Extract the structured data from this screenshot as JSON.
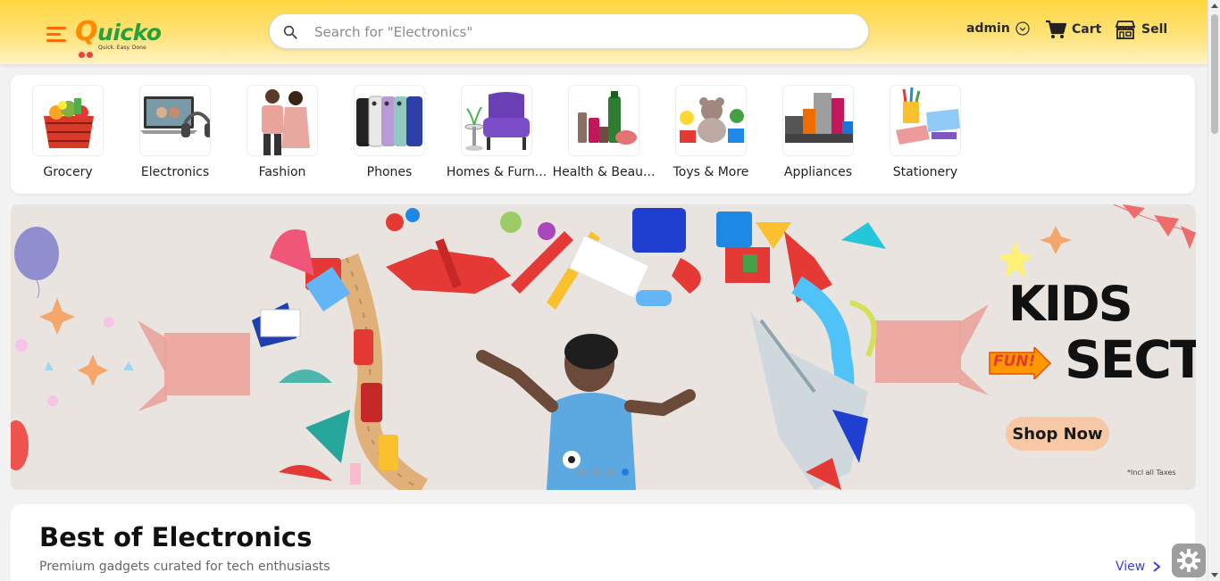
{
  "brand": {
    "name_first": "Q",
    "name_rest": "uicko",
    "tagline": "Quick. Easy. Done"
  },
  "search": {
    "placeholder": "Search for \"Electronics\"",
    "value": ""
  },
  "header": {
    "user_label": "admin",
    "cart_label": "Cart",
    "sell_label": "Sell"
  },
  "categories": [
    {
      "label": "Grocery",
      "icon": "grocery-basket"
    },
    {
      "label": "Electronics",
      "icon": "laptop-headphones"
    },
    {
      "label": "Fashion",
      "icon": "fashion-couple"
    },
    {
      "label": "Phones",
      "icon": "phones"
    },
    {
      "label": "Homes & Furn...",
      "icon": "armchair"
    },
    {
      "label": "Health & Beau...",
      "icon": "beauty-products"
    },
    {
      "label": "Toys & More",
      "icon": "toys"
    },
    {
      "label": "Appliances",
      "icon": "appliances"
    },
    {
      "label": "Stationery",
      "icon": "stationery"
    }
  ],
  "banner": {
    "title_line1": "KIDS",
    "title_line2": "SECT",
    "fun_tag": "FUN!",
    "cta_label": "Shop Now",
    "tax_note": "*Incl all Taxes",
    "slide_count": 4,
    "active_slide": 4
  },
  "section": {
    "title": "Best of Electronics",
    "subtitle": "Premium gadgets curated for tech enthusiasts",
    "view_label": "View"
  },
  "colors": {
    "header_yellow": "#ffd740",
    "brand_green": "#27a13a",
    "brand_orange": "#ff8a00",
    "link_blue": "#3d3ddb",
    "active_dot": "#1f7fe0"
  }
}
